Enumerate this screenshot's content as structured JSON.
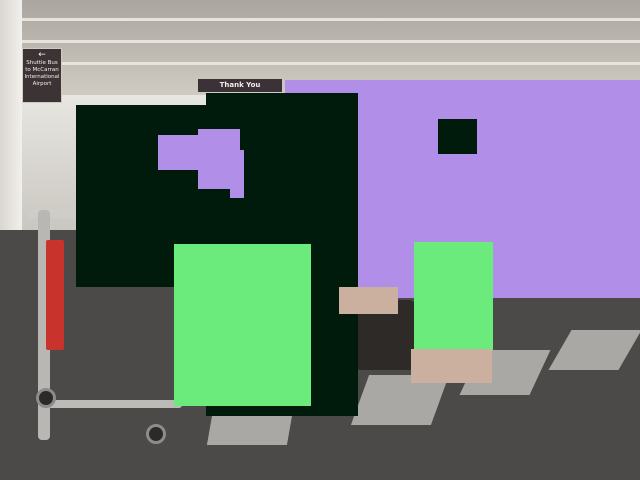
{
  "image": {
    "signs": {
      "shuttle_sign_arrow": "←",
      "shuttle_sign_text": "Shuttle Bus to McCarran International Airport",
      "banner_text": "Thank You"
    },
    "mask_colors": {
      "dark_green": "#001a0b",
      "lavender": "#b18fe9",
      "light_green": "#6aeb7b",
      "tan": "#cbb0a0"
    }
  }
}
